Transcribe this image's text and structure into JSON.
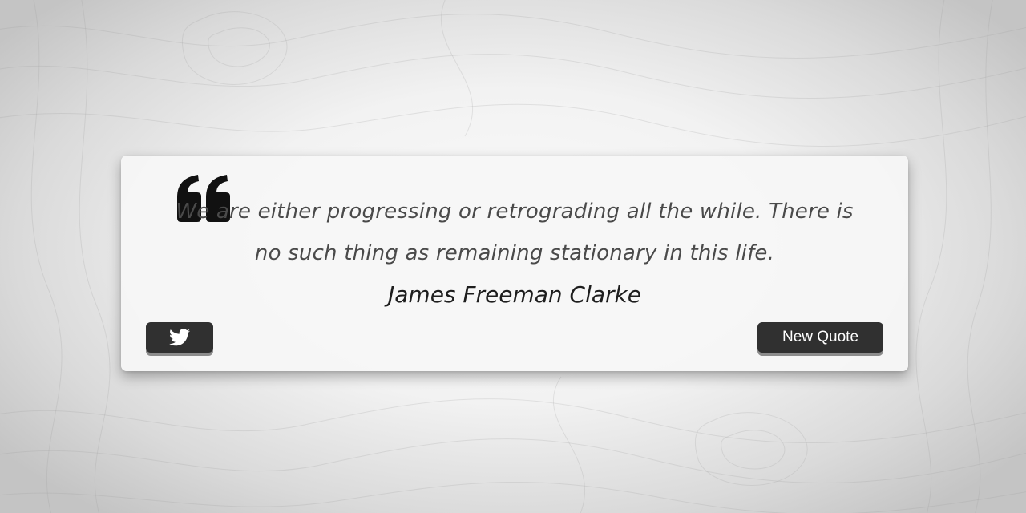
{
  "page": {
    "background_color": "#f2f2f2",
    "card_color": "#f6f6f6",
    "button_color": "#303030"
  },
  "quote": {
    "text": "We are either progressing or retrograding all the while. There is no such thing as remaining stationary in this life.",
    "author": "James Freeman Clarke",
    "quote_icon": "quote-left-icon"
  },
  "actions": {
    "tweet_icon": "twitter-bird-icon",
    "new_quote_label": "New Quote"
  }
}
